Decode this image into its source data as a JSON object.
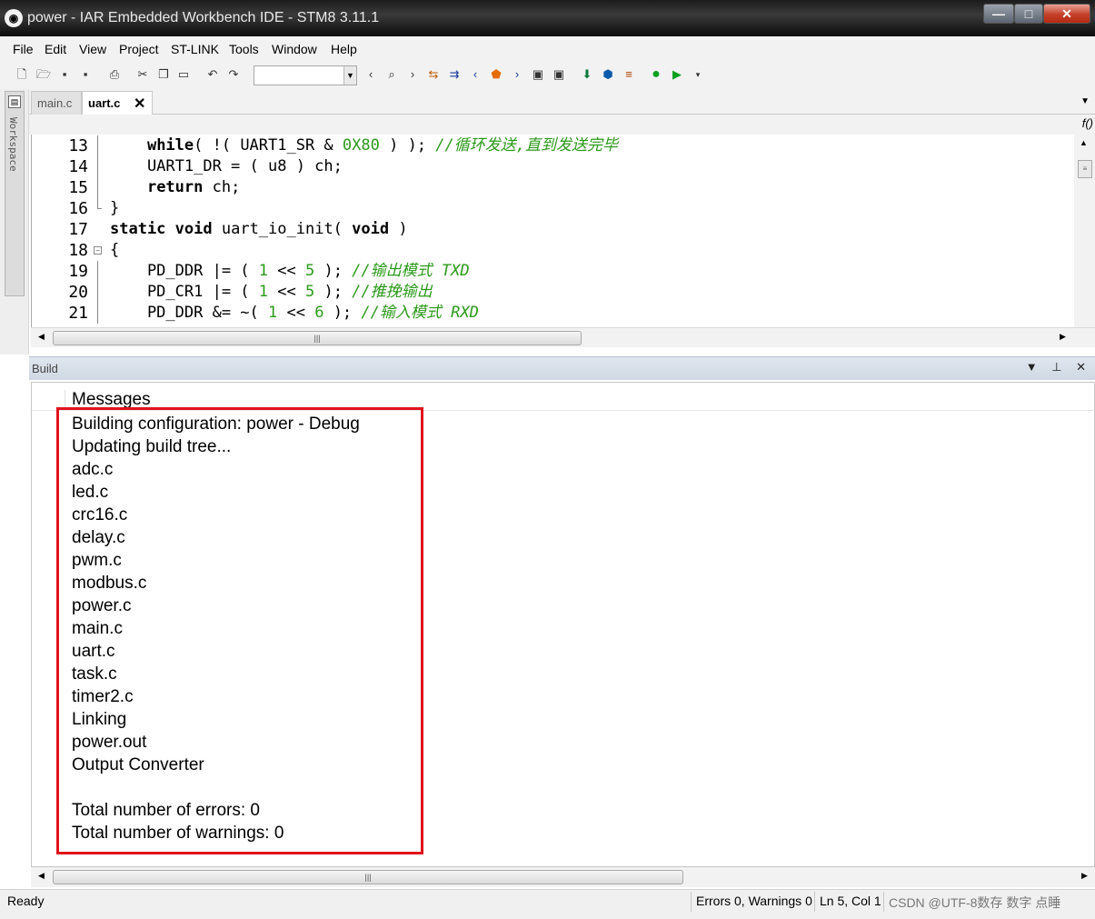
{
  "window": {
    "title": "power - IAR Embedded Workbench IDE - STM8 3.11.1",
    "min_label": "—",
    "max_label": "□",
    "close_label": "✕"
  },
  "menu": [
    "File",
    "Edit",
    "View",
    "Project",
    "ST-LINK",
    "Tools",
    "Window",
    "Help"
  ],
  "toolbar": {
    "icons": [
      "new-file-icon",
      "open-icon",
      "save-icon",
      "save-all-icon",
      "print-icon",
      "cut-icon",
      "copy-icon",
      "paste-icon",
      "undo-icon",
      "redo-icon",
      "find-combo",
      "nav-back-icon",
      "search-icon",
      "nav-forward-icon",
      "toggle-bookmark-icon",
      "next-bookmark-icon",
      "prev-icon",
      "breakpoint-icon",
      "next-icon",
      "compile-icon",
      "make-icon",
      "download-debug-icon",
      "debug-icon",
      "stop-build-icon",
      "go-icon",
      "run-icon"
    ],
    "combo_value": ""
  },
  "workspace": {
    "label": "Workspace"
  },
  "tabs": [
    {
      "label": "main.c",
      "active": false
    },
    {
      "label": "uart.c",
      "active": true
    }
  ],
  "fbar": {
    "label": "f()"
  },
  "editor": {
    "lines": [
      {
        "n": "13",
        "fold": "line"
      },
      {
        "n": "14",
        "fold": "line"
      },
      {
        "n": "15",
        "fold": "line"
      },
      {
        "n": "16",
        "fold": "end"
      },
      {
        "n": "17",
        "fold": ""
      },
      {
        "n": "18",
        "fold": "box"
      },
      {
        "n": "19",
        "fold": "line"
      },
      {
        "n": "20",
        "fold": "line"
      },
      {
        "n": "21",
        "fold": "line"
      }
    ],
    "code": [
      [
        {
          "t": "    "
        },
        {
          "t": "while",
          "c": "kw"
        },
        {
          "t": "( !( UART1_SR & "
        },
        {
          "t": "0X80",
          "c": "num"
        },
        {
          "t": " ) ); "
        },
        {
          "t": "//循环发送,直到发送完毕",
          "c": "cmt"
        }
      ],
      [
        {
          "t": "    UART1_DR = ( u8 ) ch;"
        }
      ],
      [
        {
          "t": "    "
        },
        {
          "t": "return",
          "c": "kw"
        },
        {
          "t": " ch;"
        }
      ],
      [
        {
          "t": "}"
        }
      ],
      [
        {
          "t": "static",
          "c": "kw"
        },
        {
          "t": " "
        },
        {
          "t": "void",
          "c": "kw"
        },
        {
          "t": " uart_io_init( "
        },
        {
          "t": "void",
          "c": "kw"
        },
        {
          "t": " )"
        }
      ],
      [
        {
          "t": "{"
        }
      ],
      [
        {
          "t": "    PD_DDR |= ( "
        },
        {
          "t": "1",
          "c": "num"
        },
        {
          "t": " << "
        },
        {
          "t": "5",
          "c": "num"
        },
        {
          "t": " ); "
        },
        {
          "t": "//输出模式 TXD",
          "c": "cmt"
        }
      ],
      [
        {
          "t": "    PD_CR1 |= ( "
        },
        {
          "t": "1",
          "c": "num"
        },
        {
          "t": " << "
        },
        {
          "t": "5",
          "c": "num"
        },
        {
          "t": " ); "
        },
        {
          "t": "//推挽输出",
          "c": "cmt"
        }
      ],
      [
        {
          "t": "    PD_DDR &= ~( "
        },
        {
          "t": "1",
          "c": "num"
        },
        {
          "t": " << "
        },
        {
          "t": "6",
          "c": "num"
        },
        {
          "t": " ); "
        },
        {
          "t": "//输入模式 RXD",
          "c": "cmt"
        }
      ]
    ],
    "scroll_thumb_label": "|||"
  },
  "build": {
    "title": "Build",
    "header_controls": "▼ ⊥ ✕",
    "column": "Messages",
    "messages": [
      "Building configuration: power - Debug",
      "Updating build tree...",
      "adc.c",
      "led.c",
      "crc16.c",
      "delay.c",
      "pwm.c",
      "modbus.c",
      "power.c",
      "main.c",
      "uart.c",
      "task.c",
      "timer2.c",
      "Linking",
      "power.out",
      "Output Converter",
      "",
      "Total number of errors: 0",
      "Total number of warnings: 0"
    ],
    "scroll_thumb_label": "|||"
  },
  "status": {
    "ready": "Ready",
    "errors": "Errors 0, Warnings 0",
    "position": "Ln 5, Col 1",
    "encoding": "CSDN @UTF-8数存 数字 点睡"
  },
  "colors": {
    "keyword": "#000000",
    "number": "#2b9a1a",
    "comment": "#2b9a1a",
    "highlight": "#e0121b"
  }
}
